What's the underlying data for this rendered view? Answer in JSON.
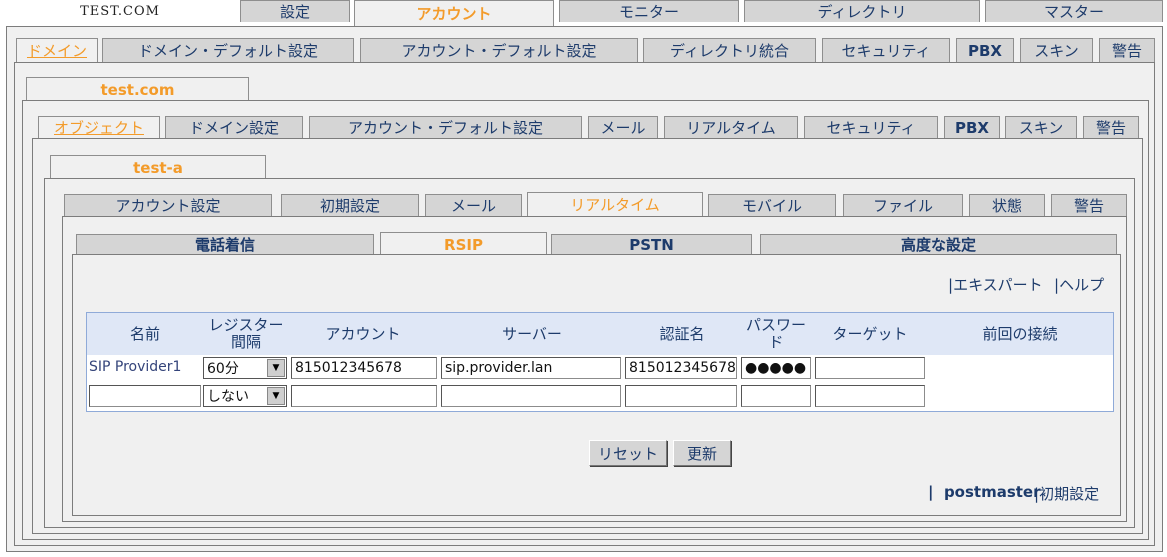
{
  "brand": "TEST.COM",
  "top_tabs": [
    "設定",
    "アカウント",
    "モニター",
    "ディレクトリ",
    "マスター"
  ],
  "domain_tabs": [
    "ドメイン",
    "ドメイン・デフォルト設定",
    "アカウント・デフォルト設定",
    "ディレクトリ統合",
    "セキュリティ",
    "PBX",
    "スキン",
    "警告"
  ],
  "domain_name": "test.com",
  "object_tabs": [
    "オブジェクト",
    "ドメイン設定",
    "アカウント・デフォルト設定",
    "メール",
    "リアルタイム",
    "セキュリティ",
    "PBX",
    "スキン",
    "警告"
  ],
  "account_name": "test-a",
  "account_tabs": [
    "アカウント設定",
    "初期設定",
    "メール",
    "リアルタイム",
    "モバイル",
    "ファイル",
    "状態",
    "警告"
  ],
  "rt_tabs": [
    "電話着信",
    "RSIP",
    "PSTN",
    "高度な設定"
  ],
  "links": {
    "expert": "エキスパート",
    "help": "ヘルプ",
    "user": "postmaster",
    "prefs": "初期設定"
  },
  "table": {
    "headers": [
      "名前",
      "レジスター間隔",
      "アカウント",
      "サーバー",
      "認証名",
      "パスワード",
      "ターゲット",
      "前回の接続"
    ],
    "row1": {
      "name": "SIP Provider1",
      "interval": "60分",
      "account": "815012345678",
      "server": "sip.provider.lan",
      "auth": "815012345678",
      "password": "●●●●●",
      "target": "",
      "last": ""
    },
    "row2": {
      "name": "",
      "interval": "しない",
      "account": "",
      "server": "",
      "auth": "",
      "password": "",
      "target": ""
    }
  },
  "buttons": {
    "reset": "リセット",
    "update": "更新"
  }
}
